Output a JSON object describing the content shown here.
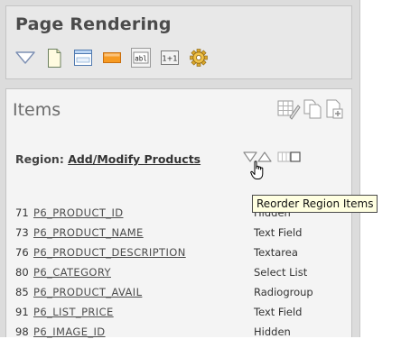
{
  "page_rendering": {
    "title": "Page Rendering",
    "toolbar_icons": [
      {
        "icon": "triangle-down-icon"
      },
      {
        "icon": "page-icon"
      },
      {
        "icon": "region-icon"
      },
      {
        "icon": "button-icon"
      },
      {
        "icon": "text-field-icon",
        "glyph": "abl"
      },
      {
        "icon": "computation-icon",
        "glyph": "1+1"
      },
      {
        "icon": "process-gear-icon"
      }
    ]
  },
  "items_panel": {
    "title": "Items",
    "actions": [
      "grid-edit-icon",
      "copy-icon",
      "create-icon"
    ],
    "region_label": "Region:",
    "region_name": "Add/Modify Products",
    "rows": [
      {
        "seq": "71",
        "name": "P6_PRODUCT_ID",
        "type": "Hidden"
      },
      {
        "seq": "73",
        "name": "P6_PRODUCT_NAME",
        "type": "Text Field"
      },
      {
        "seq": "76",
        "name": "P6_PRODUCT_DESCRIPTION",
        "type": "Textarea"
      },
      {
        "seq": "80",
        "name": "P6_CATEGORY",
        "type": "Select List"
      },
      {
        "seq": "85",
        "name": "P6_PRODUCT_AVAIL",
        "type": "Radiogroup"
      },
      {
        "seq": "91",
        "name": "P6_LIST_PRICE",
        "type": "Text Field"
      },
      {
        "seq": "98",
        "name": "P6_IMAGE_ID",
        "type": "Hidden"
      }
    ],
    "tooltip": "Reorder Region Items"
  },
  "colors": {
    "background": "#dcdcdc",
    "panel": "#e8e8e8",
    "tooltip_bg": "#ffffe1"
  }
}
